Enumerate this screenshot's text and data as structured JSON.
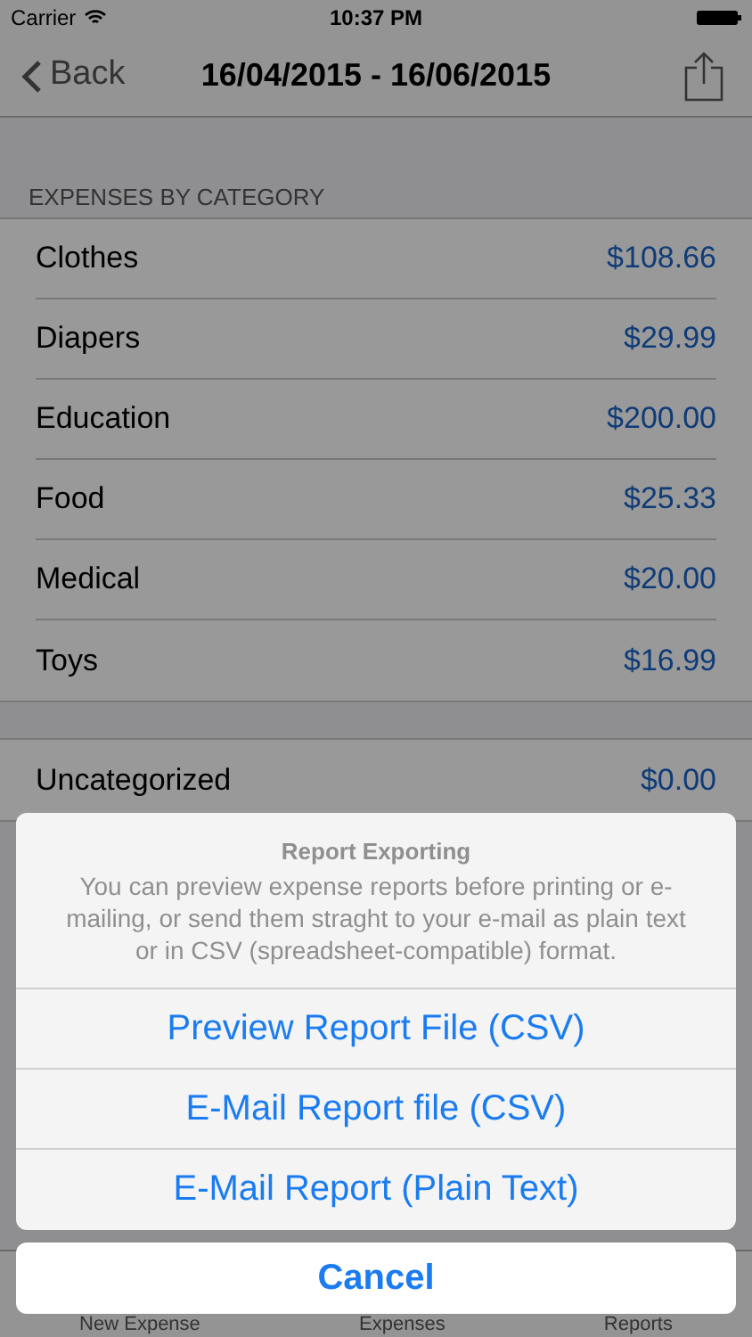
{
  "status_bar": {
    "carrier": "Carrier",
    "time": "10:37 PM"
  },
  "nav_bar": {
    "back": "Back",
    "title": "16/04/2015 - 16/06/2015"
  },
  "section_header": "EXPENSES BY CATEGORY",
  "categories": [
    {
      "name": "Clothes",
      "amount": "$108.66"
    },
    {
      "name": "Diapers",
      "amount": "$29.99"
    },
    {
      "name": "Education",
      "amount": "$200.00"
    },
    {
      "name": "Food",
      "amount": "$25.33"
    },
    {
      "name": "Medical",
      "amount": "$20.00"
    },
    {
      "name": "Toys",
      "amount": "$16.99"
    }
  ],
  "uncategorized": {
    "name": "Uncategorized",
    "amount": "$0.00"
  },
  "tab_bar": [
    {
      "label": "New Expense"
    },
    {
      "label": "Expenses"
    },
    {
      "label": "Reports"
    }
  ],
  "action_sheet": {
    "title": "Report Exporting",
    "message": "You can preview expense reports before printing or e-mailing, or send them straght to your e-mail as plain text or in CSV (spreadsheet-compatible) format.",
    "actions": [
      "Preview Report File (CSV)",
      "E-Mail Report file (CSV)",
      "E-Mail Report (Plain Text)"
    ],
    "cancel": "Cancel"
  }
}
